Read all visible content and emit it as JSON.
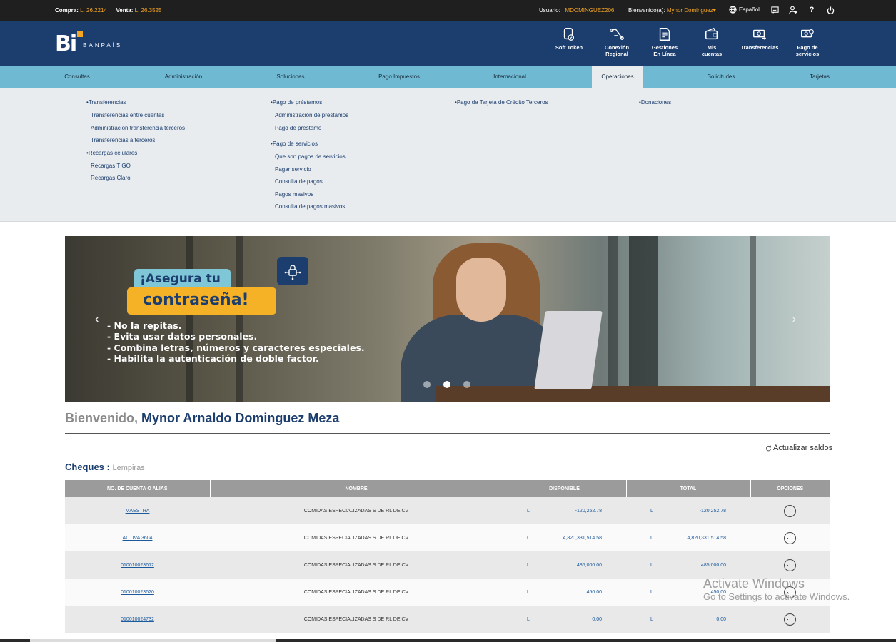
{
  "topbar": {
    "buy_label": "Compra:",
    "buy_value": "L. 26.2214",
    "sell_label": "Venta:",
    "sell_value": "L. 26.3525",
    "user_label": "Usuario:",
    "user_value": "MDOMINGUEZ206",
    "welcome_label": "Bienvenido(a):",
    "welcome_value": "Mynor Dominguez",
    "language": "Español",
    "icons": [
      "globe-icon",
      "messages-icon",
      "user-settings-icon",
      "help-icon",
      "power-icon"
    ]
  },
  "header": {
    "logo_text": "Bi",
    "brand_text": "BANPAÍS",
    "nav": [
      {
        "label": "Soft Token",
        "icon": "soft-token-icon"
      },
      {
        "label": "Conexión\nRegional",
        "icon": "regional-connection-icon"
      },
      {
        "label": "Gestiones\nEn Línea",
        "icon": "online-management-icon"
      },
      {
        "label": "Mis\ncuentas",
        "icon": "wallet-icon"
      },
      {
        "label": "Transferencias",
        "icon": "transfer-icon"
      },
      {
        "label": "Pago de\nservicios",
        "icon": "service-payment-icon"
      }
    ]
  },
  "menu": {
    "items": [
      "Consultas",
      "Administración",
      "Soluciones",
      "Pago Impuestos",
      "Internacional",
      "Operaciones",
      "Solicitudes",
      "Tarjetas"
    ],
    "active": "Operaciones"
  },
  "dropdown": {
    "col1": {
      "groups": [
        {
          "head": "Transferencias",
          "subs": [
            "Transferencias entre cuentas",
            "Administracion transferencia terceros",
            "Transferencias a terceros"
          ]
        },
        {
          "head": "Recargas celulares",
          "subs": [
            "Recargas TIGO",
            "Recargas Claro"
          ]
        }
      ]
    },
    "col2": {
      "groups": [
        {
          "head": "Pago de préstamos",
          "subs": [
            "Administración de préstamos",
            "Pago de préstamo"
          ]
        },
        {
          "head": "Pago de servicios",
          "subs": [
            "Que son pagos de servicios",
            "Pagar servicio",
            "Consulta de pagos",
            "Pagos masivos",
            "Consulta de pagos masivos"
          ]
        }
      ]
    },
    "col3": {
      "head": "Pago de Tarjeta de Crédito Terceros"
    },
    "col4": {
      "head": "Donaciones"
    }
  },
  "banner": {
    "line1": "¡Asegura tu",
    "line2": "contraseña!",
    "tips": [
      "- No la repitas.",
      "- Evita usar datos personales.",
      "- Combina letras, números y caracteres especiales.",
      "- Habilita la autenticación de doble factor."
    ],
    "active_slide": 2,
    "slide_count": 3
  },
  "welcome": {
    "greeting": "Bienvenido,",
    "name": "Mynor Arnaldo Dominguez Meza"
  },
  "refresh_label": "Actualizar saldos",
  "section": {
    "title": "Cheques :",
    "currency": "Lempiras"
  },
  "table": {
    "headers": [
      "NO. DE CUENTA O ALIAS",
      "NOMBRE",
      "DISPONIBLE",
      "TOTAL",
      "OPCIONES"
    ],
    "rows": [
      {
        "account": "MAESTRA",
        "name": "COMIDAS ESPECIALIZADAS S DE RL DE CV",
        "cur1": "L",
        "available": "-120,252.78",
        "cur2": "L",
        "total": "-120,252.78"
      },
      {
        "account": "ACTIVA 3604",
        "name": "COMIDAS ESPECIALIZADAS S DE RL DE CV",
        "cur1": "L",
        "available": "4,820,331,514.58",
        "cur2": "L",
        "total": "4,820,331,514.58"
      },
      {
        "account": "010010023612",
        "name": "COMIDAS ESPECIALIZADAS S DE RL DE CV",
        "cur1": "L",
        "available": "485,000.00",
        "cur2": "L",
        "total": "485,000.00"
      },
      {
        "account": "010010023620",
        "name": "COMIDAS ESPECIALIZADAS S DE RL DE CV",
        "cur1": "L",
        "available": "450.00",
        "cur2": "L",
        "total": "450.00"
      },
      {
        "account": "010010024732",
        "name": "COMIDAS ESPECIALIZADAS S DE RL DE CV",
        "cur1": "L",
        "available": "0.00",
        "cur2": "L",
        "total": "0.00"
      }
    ],
    "options_glyph": "⋯"
  },
  "watermark": {
    "line1": "Activate Windows",
    "line2": "Go to Settings to activate Windows."
  },
  "colors": {
    "navy": "#1c3e6e",
    "accent": "#f5a623",
    "menu": "#6fb9d2",
    "panel": "#e8ecef"
  }
}
